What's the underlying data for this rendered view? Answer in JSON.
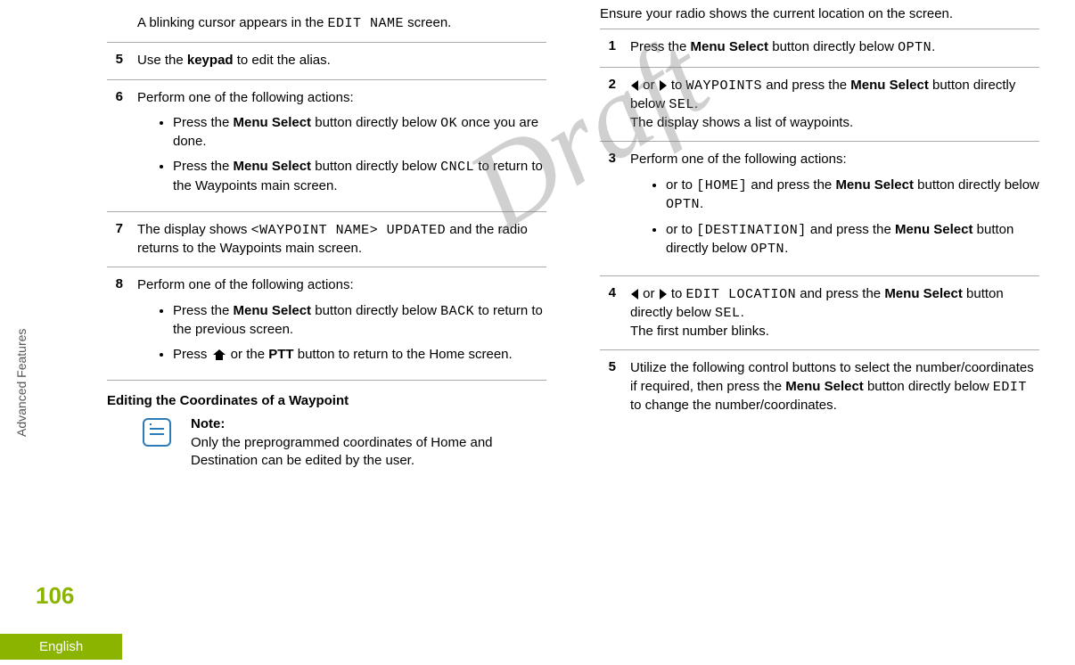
{
  "watermark": "Draft",
  "side_label": "Advanced Features",
  "page_number": "106",
  "language_tab": "English",
  "left": {
    "step4_tail_a": "A blinking cursor appears in the ",
    "step4_tail_code": "EDIT NAME",
    "step4_tail_b": " screen.",
    "step5_num": "5",
    "step5_a": "Use the ",
    "step5_b": "keypad",
    "step5_c": " to edit the alias.",
    "step6_num": "6",
    "step6_text": "Perform one of the following actions:",
    "step6_b1_a": "Press the ",
    "step6_b1_b": "Menu Select",
    "step6_b1_c": " button directly below ",
    "step6_b1_code": "OK",
    "step6_b1_d": " once you are done.",
    "step6_b2_a": "Press the ",
    "step6_b2_b": "Menu Select",
    "step6_b2_c": " button directly below ",
    "step6_b2_code": "CNCL",
    "step6_b2_d": " to return to the Waypoints main screen.",
    "step7_num": "7",
    "step7_a": "The display shows ",
    "step7_code": "<WAYPOINT NAME> UPDATED",
    "step7_b": " and the radio returns to the Waypoints main screen.",
    "step8_num": "8",
    "step8_text": "Perform one of the following actions:",
    "step8_b1_a": "Press the ",
    "step8_b1_b": "Menu Select",
    "step8_b1_c": " button directly below ",
    "step8_b1_code": "BACK",
    "step8_b1_d": " to return to the previous screen.",
    "step8_b2_a": "Press ",
    "step8_b2_b": " or the ",
    "step8_b2_c": "PTT",
    "step8_b2_d": " button to return to the Home screen.",
    "heading": "Editing the Coordinates of a Waypoint",
    "note_title": "Note:",
    "note_body": "Only the preprogrammed coordinates of Home and Destination can be edited by the user."
  },
  "right": {
    "intro": "Ensure your radio shows the current location on the screen.",
    "step1_num": "1",
    "step1_a": "Press the ",
    "step1_b": "Menu Select",
    "step1_c": " button directly below ",
    "step1_code": "OPTN",
    "step1_d": ".",
    "step2_num": "2",
    "step2_or": " or ",
    "step2_to": " to ",
    "step2_code1": "WAYPOINTS",
    "step2_a": " and press the ",
    "step2_b": "Menu Select",
    "step2_c": " button directly below ",
    "step2_code2": "SEL",
    "step2_d": ".",
    "step2_line2": "The display shows a list of waypoints.",
    "step3_num": "3",
    "step3_text": "Perform one of the following actions:",
    "step3_b1_a": " or  to ",
    "step3_b1_code": "[HOME]",
    "step3_b1_b": " and press the ",
    "step3_b1_c": "Menu Select",
    "step3_b1_d": " button directly below ",
    "step3_b1_code2": "OPTN",
    "step3_b1_e": ".",
    "step3_b2_a": " or  to ",
    "step3_b2_code": "[DESTINATION]",
    "step3_b2_b": " and press the ",
    "step3_b2_c": "Menu Select",
    "step3_b2_d": " button directly below ",
    "step3_b2_code2": "OPTN",
    "step3_b2_e": ".",
    "step4_num": "4",
    "step4_or": " or ",
    "step4_to": " to ",
    "step4_code1": "EDIT LOCATION",
    "step4_a": " and press the ",
    "step4_b": "Menu Select",
    "step4_c": " button directly below ",
    "step4_code2": "SEL",
    "step4_d": ".",
    "step4_line2": "The first number blinks.",
    "step5_num": "5",
    "step5_a": "Utilize the following control buttons to select the number/coordinates if required, then press the ",
    "step5_b": "Menu Select",
    "step5_c": " button directly below ",
    "step5_code": "EDIT",
    "step5_d": " to change the number/coordinates."
  }
}
